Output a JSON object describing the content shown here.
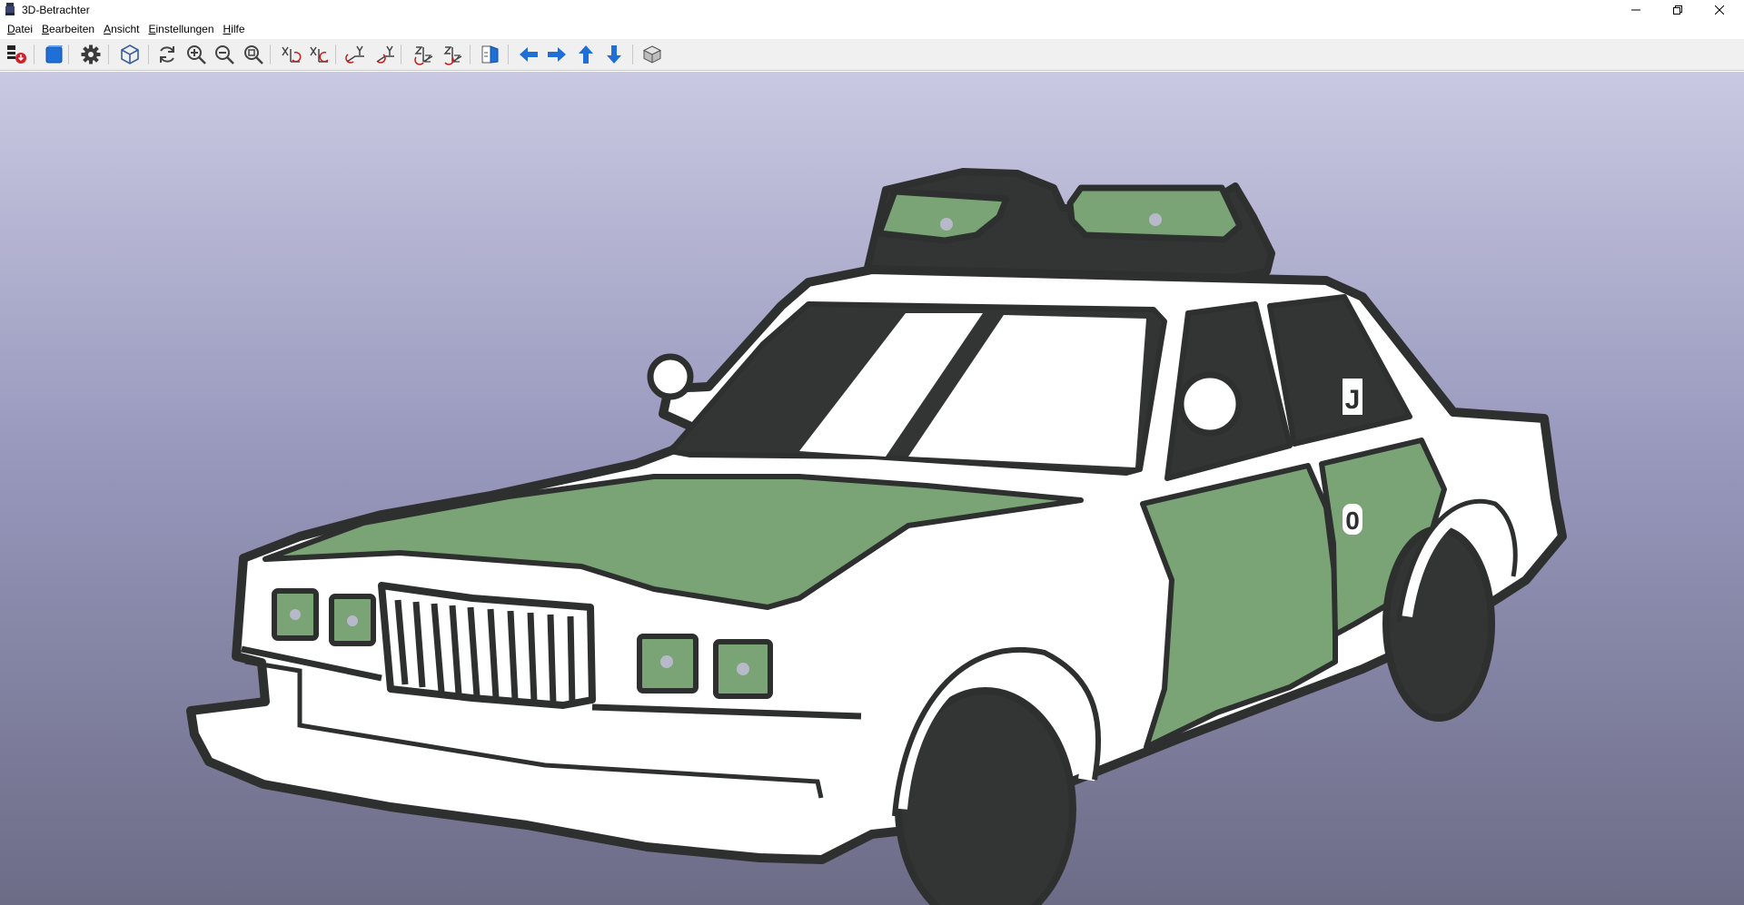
{
  "window": {
    "title": "3D-Betrachter",
    "controls": [
      "minimize-icon",
      "restore-icon",
      "close-icon"
    ]
  },
  "menu": [
    {
      "underline": "D",
      "rest": "atei"
    },
    {
      "underline": "B",
      "rest": "earbeiten"
    },
    {
      "underline": "A",
      "rest": "nsicht"
    },
    {
      "underline": "E",
      "rest": "instellungen"
    },
    {
      "underline": "H",
      "rest": "ilfe"
    }
  ],
  "toolbar": {
    "buttons": [
      "export-icon",
      "color-cube-icon",
      "settings-gear-icon",
      "view-3d-icon",
      "refresh-icon",
      "zoom-in-icon",
      "zoom-out-icon",
      "zoom-fit-icon",
      "rotate-x-cw-icon",
      "rotate-x-ccw-icon",
      "rotate-y-cw-icon",
      "rotate-y-ccw-icon",
      "rotate-z-cw-icon",
      "rotate-z-ccw-icon",
      "flip-board-icon",
      "pan-left-icon",
      "pan-right-icon",
      "pan-up-icon",
      "pan-down-icon",
      "ortho-view-icon"
    ]
  },
  "scene": {
    "model_text": [
      "J",
      "0"
    ],
    "colors": {
      "body": "#ffffff",
      "outline": "#2e302f",
      "panel_green": "#7aa476",
      "dark": "#333534",
      "bg_top": "#c9c9e2",
      "bg_bottom": "#6c6c87"
    }
  }
}
